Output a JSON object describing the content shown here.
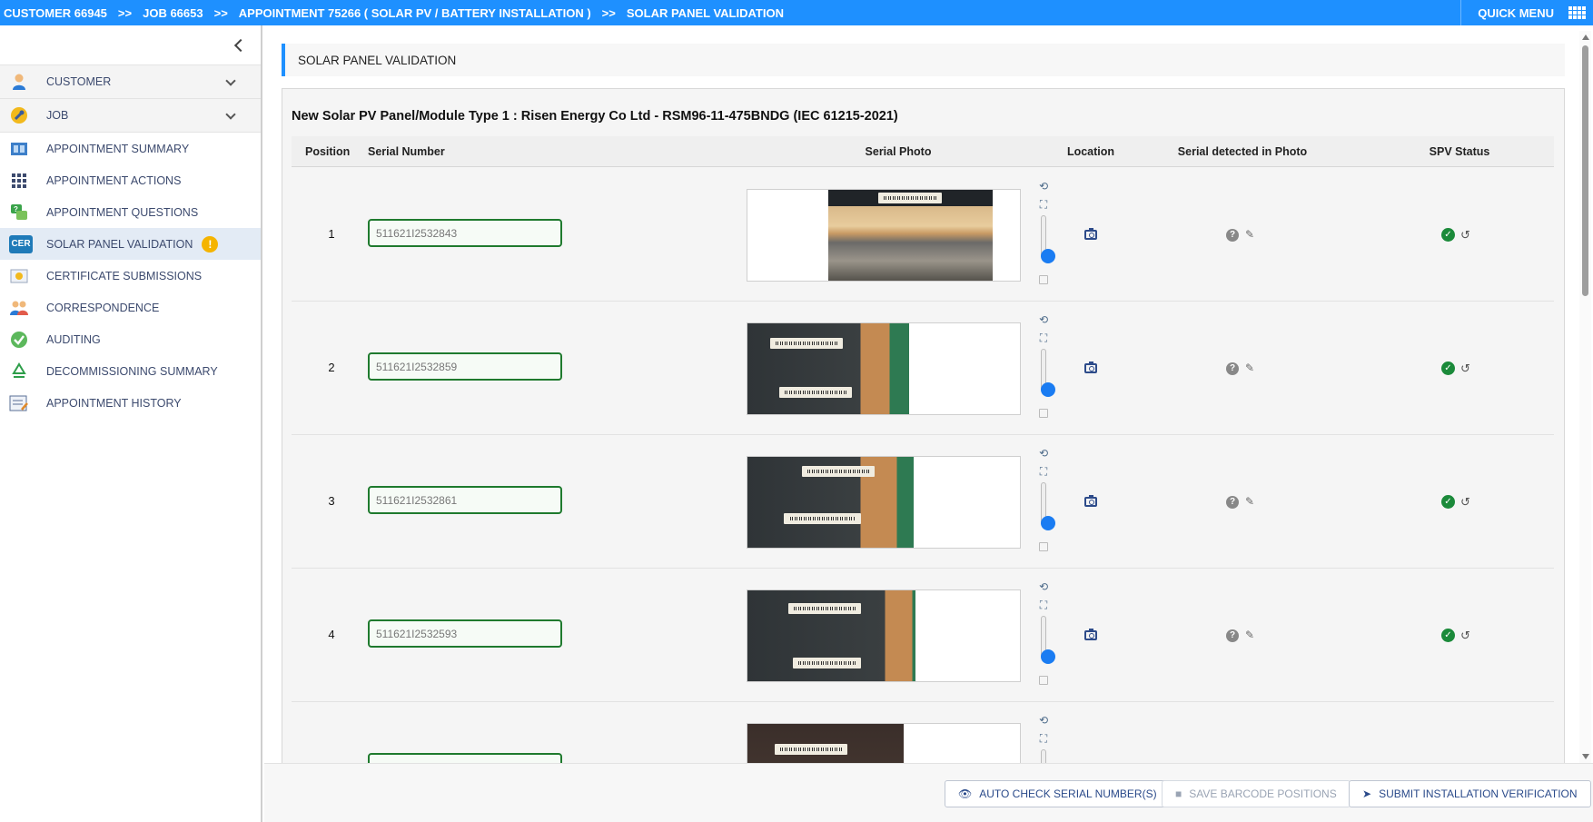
{
  "topbar": {
    "breadcrumbs": [
      "CUSTOMER 66945",
      "JOB 66653",
      "APPOINTMENT 75266 ( SOLAR PV / BATTERY INSTALLATION )",
      "SOLAR PANEL VALIDATION"
    ],
    "separator": ">>",
    "quick_menu": "QUICK MENU"
  },
  "sidebar": {
    "items": [
      {
        "label": "CUSTOMER",
        "icon": "person-icon"
      },
      {
        "label": "JOB",
        "icon": "wrench-icon"
      },
      {
        "label": "APPOINTMENT SUMMARY",
        "icon": "columns-icon"
      },
      {
        "label": "APPOINTMENT ACTIONS",
        "icon": "grid-icon"
      },
      {
        "label": "APPOINTMENT QUESTIONS",
        "icon": "questions-icon"
      },
      {
        "label": "SOLAR PANEL VALIDATION",
        "icon": "cer-icon",
        "icon_text": "CER",
        "badge": "!"
      },
      {
        "label": "CERTIFICATE SUBMISSIONS",
        "icon": "certificate-icon"
      },
      {
        "label": "CORRESPONDENCE",
        "icon": "people-icon"
      },
      {
        "label": "AUDITING",
        "icon": "check-badge-icon"
      },
      {
        "label": "DECOMMISSIONING SUMMARY",
        "icon": "recycle-icon"
      },
      {
        "label": "APPOINTMENT HISTORY",
        "icon": "history-icon"
      }
    ]
  },
  "main": {
    "page_title": "SOLAR PANEL VALIDATION",
    "panel_title": "New Solar PV Panel/Module Type 1 : Risen Energy Co Ltd - RSM96-11-475BNDG (IEC 61215-2021)",
    "columns": [
      "Position",
      "Serial Number",
      "Serial Photo",
      "Location",
      "Serial detected in Photo",
      "SPV Status"
    ],
    "rows": [
      {
        "position": "1",
        "serial": "511621I2532843"
      },
      {
        "position": "2",
        "serial": "511621I2532859"
      },
      {
        "position": "3",
        "serial": "511621I2532861"
      },
      {
        "position": "4",
        "serial": "511621I2532593"
      },
      {
        "position": "",
        "serial": ""
      }
    ]
  },
  "footer": {
    "auto_check": "AUTO CHECK SERIAL NUMBER(S)",
    "save_barcode": "SAVE BARCODE POSITIONS",
    "submit": "SUBMIT INSTALLATION VERIFICATION"
  },
  "colors": {
    "accent": "#1e90ff",
    "valid_border": "#1f7a2e",
    "status_ok": "#1b8a3a",
    "warning": "#f5b400",
    "nav_text": "#3c4a6e"
  }
}
